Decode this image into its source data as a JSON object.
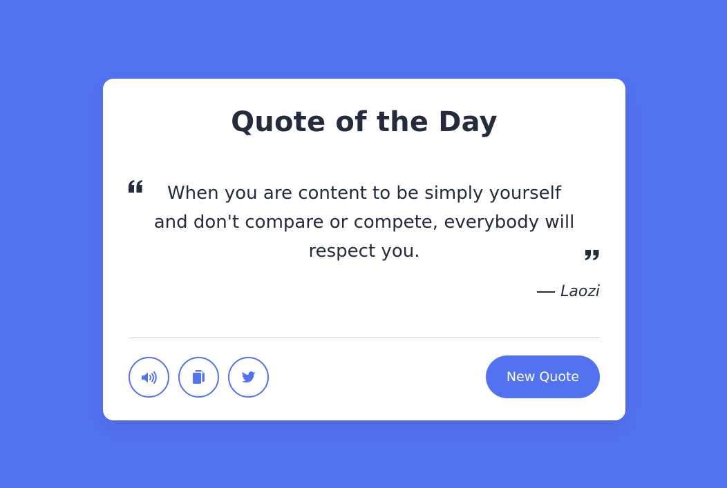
{
  "page": {
    "background_color": "#5372f0"
  },
  "card": {
    "title": "Quote of the Day",
    "quote": {
      "text": "When you are content to be simply yourself and don't compare or compete, everybody will respect you.",
      "open_icon": "quote-left-icon",
      "close_icon": "quote-right-icon"
    },
    "author": {
      "name": "Laozi"
    },
    "buttons": {
      "speak_icon": "volume-icon",
      "copy_icon": "copy-icon",
      "twitter_icon": "twitter-icon",
      "new_quote_label": "New Quote"
    },
    "colors": {
      "accent": "#5372f0",
      "text": "#242b3d",
      "divider": "#cccccc"
    }
  }
}
